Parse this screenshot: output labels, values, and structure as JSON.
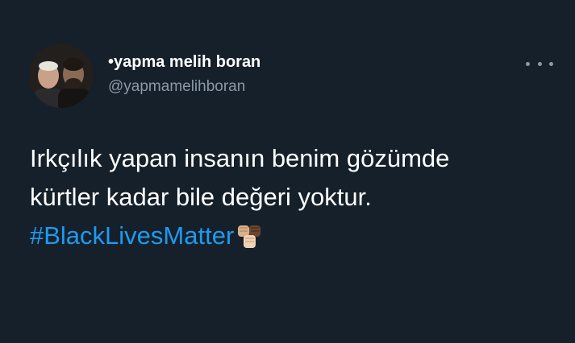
{
  "tweet": {
    "display_name": "•yapma melih boran",
    "handle": "@yapmamelihboran",
    "text_line_1": "Irkçılık yapan insanın benim gözümde",
    "text_line_2": "kürtler kadar bile değeri yoktur.",
    "hashtag": "#BlackLivesMatter",
    "emoji": "raised-fist-skin-tones-icon"
  },
  "menu": {
    "icon": "more-options-icon"
  },
  "colors": {
    "background": "#15202b",
    "text_primary": "#ffffff",
    "text_secondary": "#8b98a5",
    "link": "#1d9bf0"
  }
}
